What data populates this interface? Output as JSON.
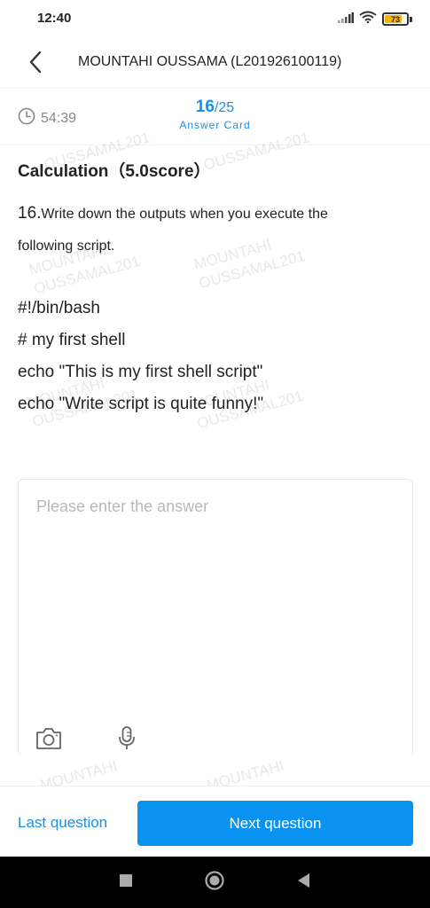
{
  "status_bar": {
    "time": "12:40",
    "battery": "73",
    "icons": [
      "signal-icon",
      "wifi-icon",
      "battery-icon"
    ]
  },
  "header": {
    "title": "MOUNTAHI OUSSAMA (L201926100119)",
    "back_icon": "chevron-left-icon"
  },
  "info": {
    "timer": "54:39",
    "current": "16",
    "total": "/25",
    "answer_card": "Answer Card"
  },
  "question": {
    "heading": "Calculation",
    "score": "（5.0score）",
    "number": "16.",
    "text_line1": "Write down the outputs when you execute the",
    "text_line2": "following script.",
    "code": [
      "#!/bin/bash",
      "# my first shell",
      "echo \"This is my first shell script\"",
      "echo \"Write script is quite funny!\""
    ]
  },
  "watermark": {
    "line1": "MOUNTAHI",
    "line2": "OUSSAMAL201"
  },
  "answer": {
    "placeholder": "Please enter the answer",
    "value": "",
    "tools": [
      "camera-icon",
      "microphone-icon"
    ]
  },
  "footer": {
    "last_label": "Last question",
    "next_label": "Next question"
  },
  "colors": {
    "accent": "#1a8fe3",
    "button": "#0a92f0",
    "battery": "#f5b400"
  }
}
